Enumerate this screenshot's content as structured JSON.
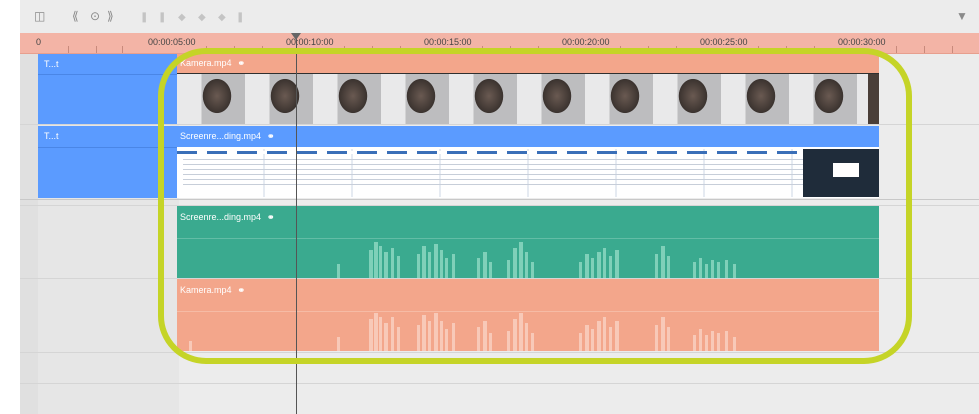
{
  "toolbar": {
    "icons": [
      "clip-window-icon",
      "rewind-icon",
      "loop-icon",
      "fast-forward-icon",
      "marker-1-icon",
      "marker-2-icon",
      "marker-3-icon",
      "marker-4-icon",
      "marker-5-icon",
      "marker-6-icon",
      "pin-icon"
    ]
  },
  "ruler": {
    "start": "0",
    "labels": [
      "00:00:05:00",
      "00:00:10:00",
      "00:00:15:00",
      "00:00:20:00",
      "00:00:25:00",
      "00:00:30:00"
    ]
  },
  "tracks": {
    "video_track_1_label": "T...t",
    "video_track_2_label": "T...t"
  },
  "clips": {
    "camera_video": {
      "name": "Kamera.mp4",
      "title_color": "#f3a68b",
      "body_color": "#2f2f2f"
    },
    "screen_video": {
      "name": "Screenre...ding.mp4",
      "title_color": "#5b9bff",
      "body_color": "#ffffff"
    },
    "screen_audio": {
      "name": "Screenre...ding.mp4",
      "color": "#3aaa8f"
    },
    "camera_audio": {
      "name": "Kamera.mp4",
      "color": "#f3a68b"
    }
  },
  "colors": {
    "highlight": "#c5d427",
    "video_track": "#5b9bff",
    "ruler": "#f3b4a6"
  }
}
